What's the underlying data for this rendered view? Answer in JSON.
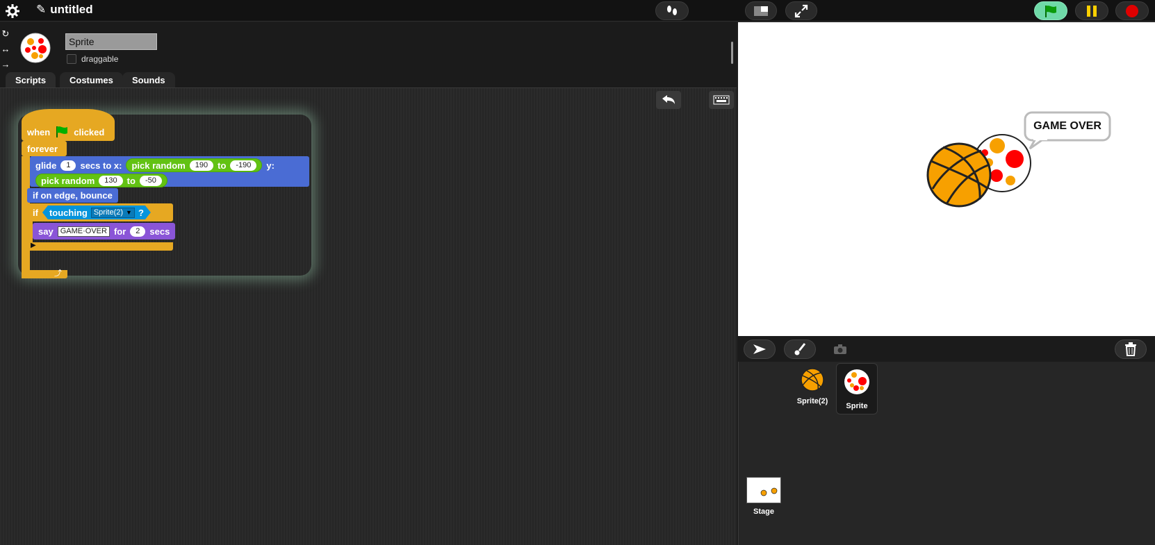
{
  "app": {
    "title": "untitled"
  },
  "sprite": {
    "name": "Sprite",
    "draggable_label": "draggable"
  },
  "tabs": [
    {
      "label": "Scripts"
    },
    {
      "label": "Costumes"
    },
    {
      "label": "Sounds"
    }
  ],
  "script": {
    "hat": {
      "when": "when",
      "clicked": "clicked"
    },
    "forever": "forever",
    "glide": {
      "label": "glide",
      "secs": "1",
      "secs_to_x": "secs to x:",
      "y": "y:"
    },
    "pick1": {
      "label": "pick random",
      "from": "190",
      "to_label": "to",
      "to": "-190"
    },
    "pick2": {
      "label": "pick random",
      "from": "130",
      "to_label": "to",
      "to": "-50"
    },
    "bounce": "if on edge, bounce",
    "if_label": "if",
    "touching": {
      "label": "touching",
      "target": "Sprite(2)",
      "q": "?"
    },
    "say": {
      "label": "say",
      "text": "GAME·OVER",
      "for": "for",
      "secs": "2",
      "secs_label": "secs"
    }
  },
  "stage": {
    "speech": "GAME OVER"
  },
  "corral": {
    "sprites": [
      {
        "label": "Sprite(2)"
      },
      {
        "label": "Sprite"
      }
    ],
    "stage_label": "Stage"
  },
  "colors": {
    "control": "#e6a822",
    "motion": "#4a6cd4",
    "operators": "#62c213",
    "sensing": "#0494dc",
    "looks": "#8a55d7",
    "green_flag": "#00b000"
  }
}
